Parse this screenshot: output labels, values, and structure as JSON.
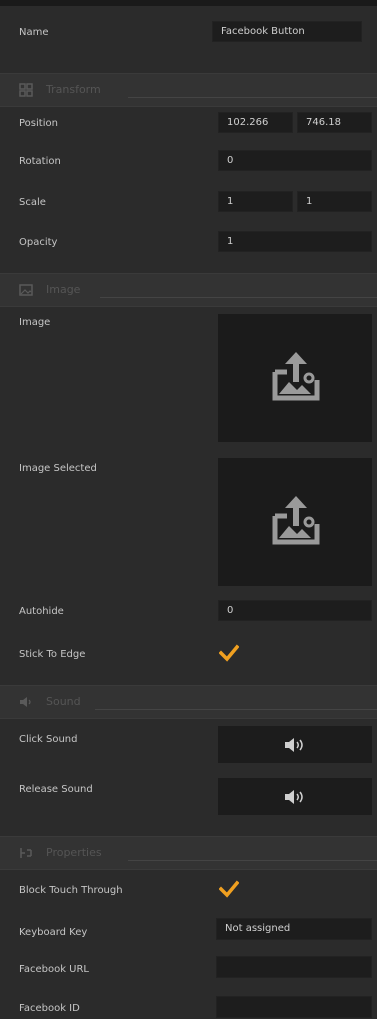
{
  "header": {
    "name_label": "Name",
    "name_value": "Facebook Button"
  },
  "sections": {
    "transform": "Transform",
    "image": "Image",
    "sound": "Sound",
    "properties": "Properties"
  },
  "transform": {
    "position_label": "Position",
    "position_x": "102.266",
    "position_y": "746.18",
    "rotation_label": "Rotation",
    "rotation_value": "0",
    "scale_label": "Scale",
    "scale_x": "1",
    "scale_y": "1",
    "opacity_label": "Opacity",
    "opacity_value": "1"
  },
  "image": {
    "image_label": "Image",
    "image_selected_label": "Image Selected",
    "autohide_label": "Autohide",
    "autohide_value": "0",
    "stick_label": "Stick To Edge",
    "stick_checked": true
  },
  "sound": {
    "click_label": "Click Sound",
    "release_label": "Release Sound"
  },
  "properties": {
    "block_touch_label": "Block Touch Through",
    "block_touch_checked": true,
    "keyboard_label": "Keyboard Key",
    "keyboard_value": "Not assigned",
    "fb_url_label": "Facebook URL",
    "fb_url_value": "",
    "fb_id_label": "Facebook ID",
    "fb_id_value": ""
  },
  "colors": {
    "accent": "#f0a020",
    "panel": "#2b2b2b",
    "field": "#1d1d1d"
  }
}
